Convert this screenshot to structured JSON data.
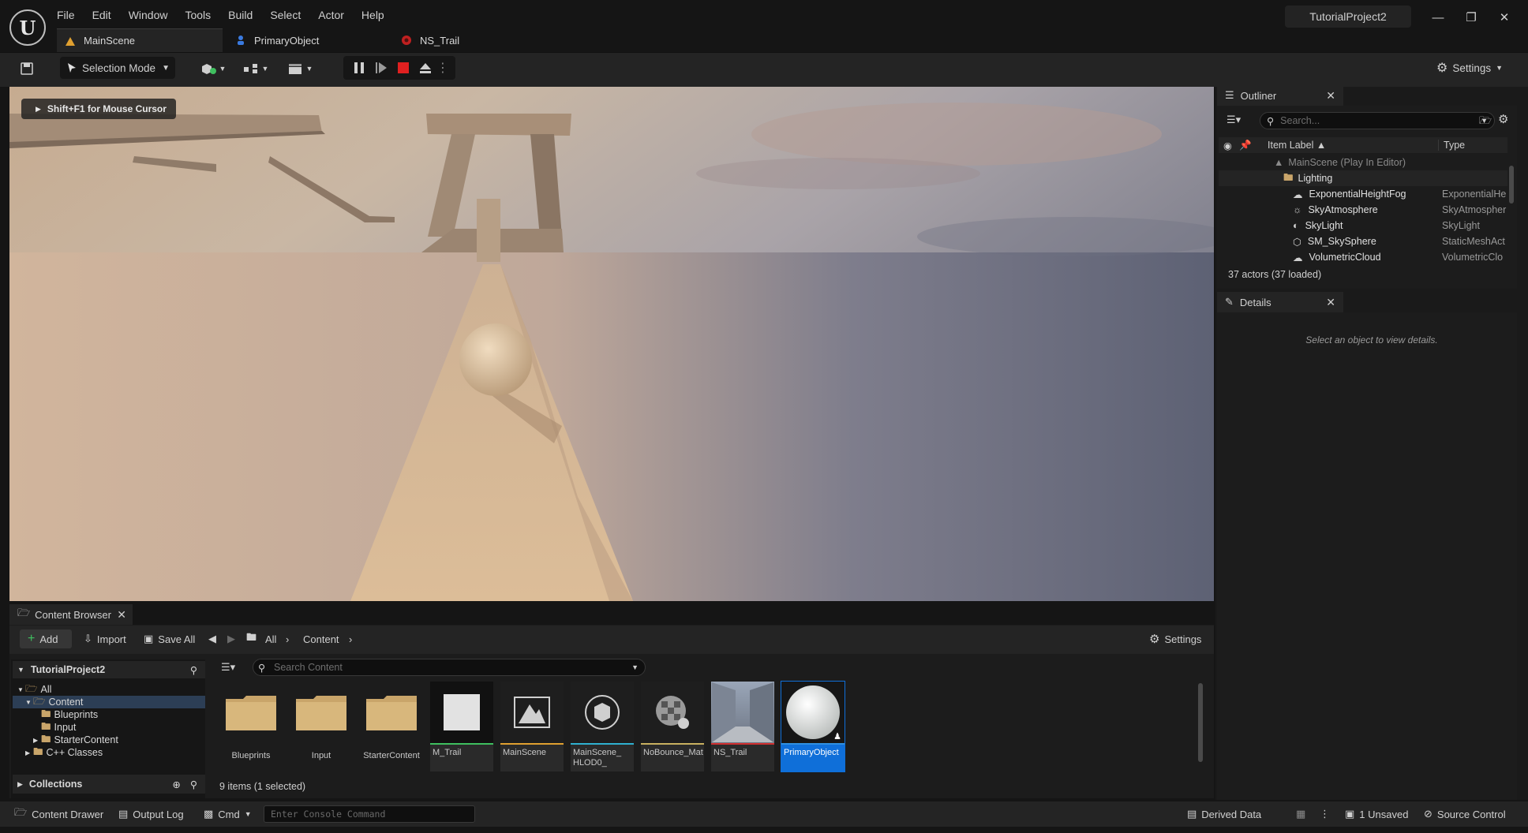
{
  "app": {
    "project_name": "TutorialProject2",
    "logo_letter": "U",
    "menu": [
      "File",
      "Edit",
      "Window",
      "Tools",
      "Build",
      "Select",
      "Actor",
      "Help"
    ]
  },
  "tabs": [
    {
      "label": "MainScene",
      "active": true,
      "icon": "level-icon"
    },
    {
      "label": "PrimaryObject",
      "active": false,
      "icon": "pawn-icon"
    },
    {
      "label": "NS_Trail",
      "active": false,
      "icon": "niagara-icon"
    }
  ],
  "toolbar": {
    "selection_mode": "Selection Mode",
    "settings": "Settings"
  },
  "viewport": {
    "hint": "Shift+F1 for Mouse Cursor"
  },
  "outliner": {
    "title": "Outliner",
    "search_placeholder": "Search...",
    "columns": {
      "label": "Item Label ▲",
      "type": "Type"
    },
    "rows": [
      {
        "label": "MainScene (Play In Editor)",
        "type": "",
        "kind": "scene"
      },
      {
        "label": "Lighting",
        "type": "",
        "kind": "folder"
      },
      {
        "label": "ExponentialHeightFog",
        "type": "ExponentialHe",
        "kind": "actor"
      },
      {
        "label": "SkyAtmosphere",
        "type": "SkyAtmospher",
        "kind": "actor"
      },
      {
        "label": "SkyLight",
        "type": "SkyLight",
        "kind": "actor"
      },
      {
        "label": "SM_SkySphere",
        "type": "StaticMeshAct",
        "kind": "actor"
      },
      {
        "label": "VolumetricCloud",
        "type": "VolumetricClo",
        "kind": "actor"
      }
    ],
    "footer": "37 actors (37 loaded)"
  },
  "details": {
    "title": "Details",
    "empty": "Select an object to view details."
  },
  "content_browser": {
    "title": "Content Browser",
    "add": "Add",
    "import": "Import",
    "save_all": "Save All",
    "path": [
      "All",
      "Content"
    ],
    "settings": "Settings",
    "search_placeholder": "Search Content",
    "sources_root": "TutorialProject2",
    "tree": [
      {
        "label": "All",
        "level": 0
      },
      {
        "label": "Content",
        "level": 1
      },
      {
        "label": "Blueprints",
        "level": 2
      },
      {
        "label": "Input",
        "level": 2
      },
      {
        "label": "StarterContent",
        "level": 2
      },
      {
        "label": "C++ Classes",
        "level": 1
      }
    ],
    "collections": "Collections",
    "assets": [
      {
        "label": "Blueprints",
        "kind": "folder",
        "color": ""
      },
      {
        "label": "Input",
        "kind": "folder",
        "color": ""
      },
      {
        "label": "StarterContent",
        "kind": "folder",
        "color": ""
      },
      {
        "label": "M_Trail",
        "kind": "material",
        "color": "#3fbf5f"
      },
      {
        "label": "MainScene",
        "kind": "level",
        "color": "#e0a030"
      },
      {
        "label": "MainScene_ HLOD0_",
        "kind": "hlod",
        "color": "#2fb0d0"
      },
      {
        "label": "NoBounce_Mat",
        "kind": "physmat",
        "color": "#c8b060"
      },
      {
        "label": "NS_Trail",
        "kind": "niagara",
        "color": "#d03030"
      },
      {
        "label": "PrimaryObject",
        "kind": "blueprint",
        "color": "#3090e0"
      }
    ],
    "items_count": "9 items (1 selected)"
  },
  "statusbar": {
    "content_drawer": "Content Drawer",
    "output_log": "Output Log",
    "cmd": "Cmd",
    "console_placeholder": "Enter Console Command",
    "derived_data": "Derived Data",
    "unsaved": "1 Unsaved",
    "source_control": "Source Control"
  },
  "colors": {
    "accent": "#0f6fd9",
    "stop": "#e02020",
    "folder": "#c9a56a"
  }
}
